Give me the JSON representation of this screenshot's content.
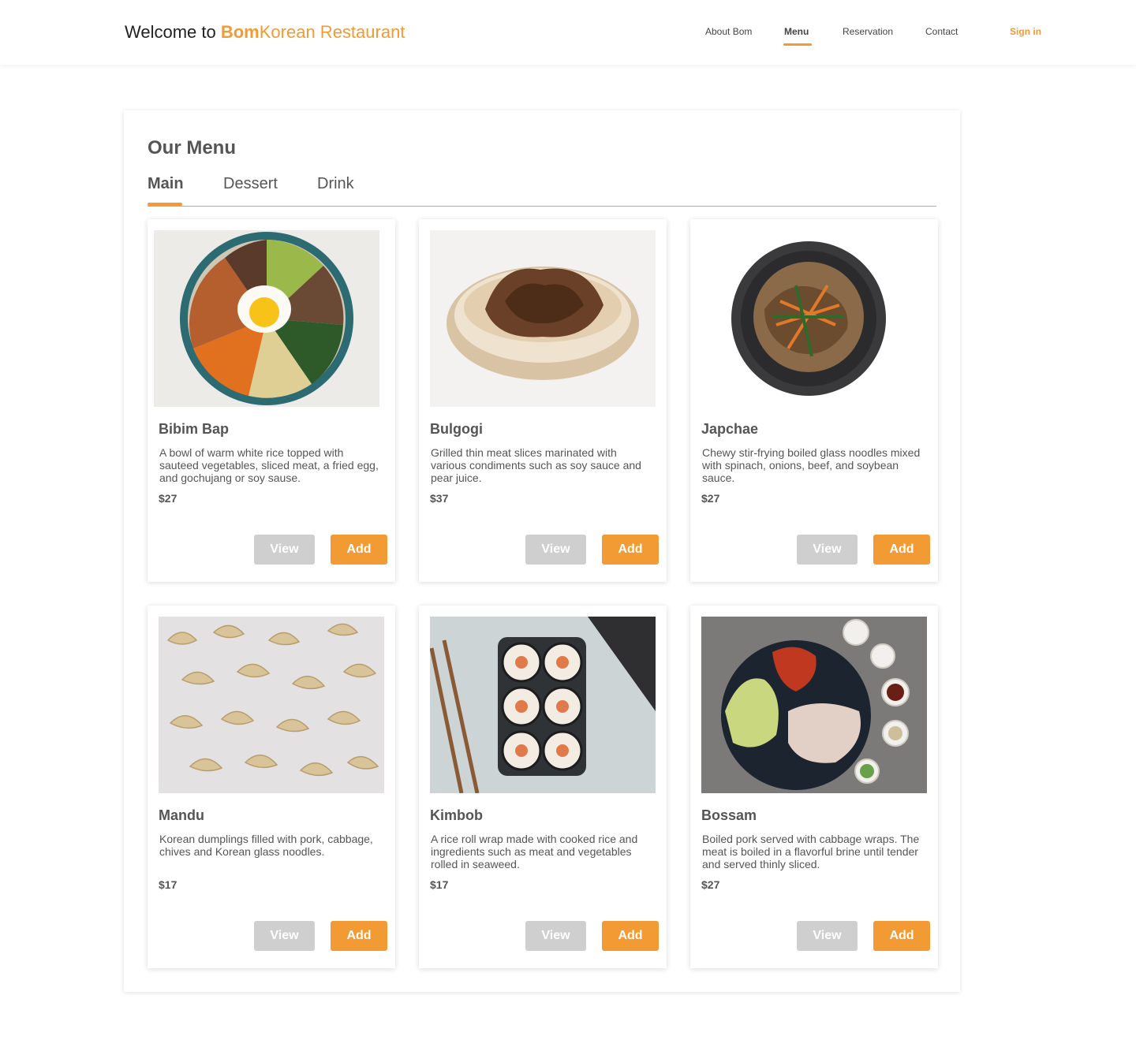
{
  "header": {
    "welcome": "Welcome to ",
    "brand_bold": "Bom",
    "brand_rest": "Korean Restaurant",
    "nav": [
      "About Bom",
      "Menu",
      "Reservation",
      "Contact"
    ],
    "active_nav": "Menu",
    "signin": "Sign in"
  },
  "menu": {
    "title": "Our Menu",
    "tabs": [
      "Main",
      "Dessert",
      "Drink"
    ],
    "active_tab": "Main",
    "view_label": "View",
    "add_label": "Add",
    "items": [
      {
        "name": "Bibim Bap",
        "desc": "A bowl of warm white rice topped with sauteed vegetables, sliced meat, a fried egg, and gochujang or soy sause.",
        "price": "$27"
      },
      {
        "name": "Bulgogi",
        "desc": "Grilled thin meat slices marinated with various condiments such as soy sauce and pear juice.",
        "price": "$37"
      },
      {
        "name": "Japchae",
        "desc": "Chewy stir-frying boiled glass noodles mixed with spinach, onions, beef, and soybean sauce.",
        "price": "$27"
      },
      {
        "name": "Mandu",
        "desc": "Korean dumplings filled with pork, cabbage, chives and Korean glass noodles.",
        "price": "$17"
      },
      {
        "name": "Kimbob",
        "desc": "A rice roll wrap made with cooked rice and ingredients such as meat and vegetables rolled in seaweed.",
        "price": "$17"
      },
      {
        "name": "Bossam",
        "desc": "Boiled pork served with cabbage wraps. The meat is boiled in a flavorful brine until tender and served thinly sliced.",
        "price": "$27"
      }
    ]
  },
  "colors": {
    "accent": "#f29a33",
    "view_button": "#cfcfcf",
    "text": "#555555"
  }
}
